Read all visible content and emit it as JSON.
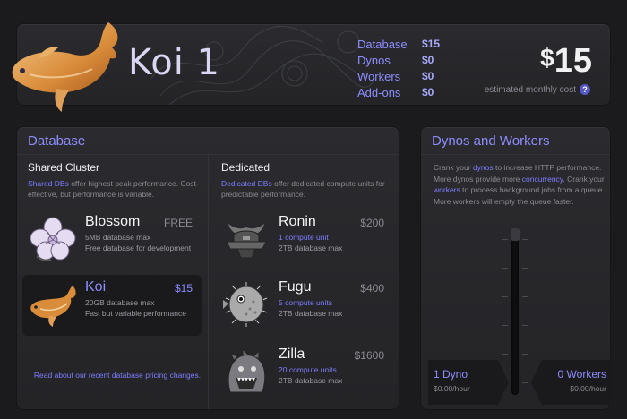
{
  "header": {
    "app_name": "Koi 1",
    "summary": [
      {
        "label": "Database",
        "value": "$15"
      },
      {
        "label": "Dynos",
        "value": "$0"
      },
      {
        "label": "Workers",
        "value": "$0"
      },
      {
        "label": "Add-ons",
        "value": "$0"
      }
    ],
    "total_currency": "$",
    "total_amount": "15",
    "estimated_label": "estimated monthly cost",
    "help": "?"
  },
  "database": {
    "title": "Database",
    "shared": {
      "heading": "Shared Cluster",
      "link": "Shared DBs",
      "desc": " offer highest peak performance. Cost-effective, but performance is variable.",
      "plans": [
        {
          "name": "Blossom",
          "price": "FREE",
          "line1": "5MB database max",
          "line2": "Free database for development",
          "icon": "blossom-icon"
        },
        {
          "name": "Koi",
          "price": "$15",
          "line1": "20GB database max",
          "line2": "Fast but variable performance",
          "icon": "koi-fish-icon"
        }
      ]
    },
    "dedicated": {
      "heading": "Dedicated",
      "link": "Dedicated DBs",
      "desc": " offer dedicated compute units for predictable performance.",
      "plans": [
        {
          "name": "Ronin",
          "price": "$200",
          "line1": "1 compute unit",
          "line2": "2TB database max",
          "icon": "samurai-helmet-icon"
        },
        {
          "name": "Fugu",
          "price": "$400",
          "line1": "5 compute units",
          "line2": "2TB database max",
          "icon": "pufferfish-icon"
        },
        {
          "name": "Zilla",
          "price": "$1600",
          "line1": "20 compute units",
          "line2": "2TB database max",
          "icon": "monster-icon"
        }
      ]
    },
    "read_more": "Read about our recent database pricing changes."
  },
  "dynos": {
    "title": "Dynos and Workers",
    "desc_parts": [
      "Crank your ",
      "dynos",
      " to increase HTTP performance. More dynos provide more ",
      "concurrency",
      ". Crank your ",
      "workers",
      " to process background jobs from a queue. More workers will empty the queue faster."
    ],
    "slider_level": 0,
    "dyno_count": "1 Dyno",
    "dyno_price": "$0.00/hour",
    "worker_count": "0 Workers",
    "worker_price": "$0.00/hour"
  },
  "colors": {
    "accent": "#8d8dff",
    "background": "#1b1b1d",
    "panel": "#2b2b2f"
  }
}
